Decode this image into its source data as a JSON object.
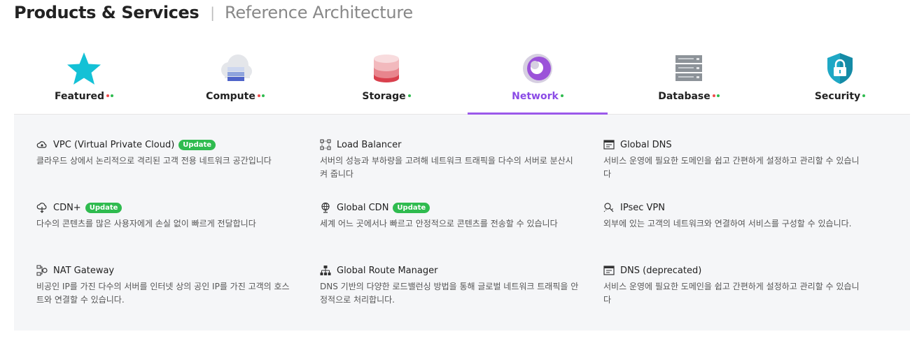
{
  "header": {
    "title": "Products & Services",
    "separator": "|",
    "subtitle": "Reference Architecture"
  },
  "tabs": [
    {
      "label": "Featured",
      "icon": "star-icon",
      "dots": [
        "red",
        "green"
      ],
      "active": false
    },
    {
      "label": "Compute",
      "icon": "cloud-server-icon",
      "dots": [
        "red",
        "green"
      ],
      "active": false
    },
    {
      "label": "Storage",
      "icon": "storage-drum-icon",
      "dots": [
        "green"
      ],
      "active": false
    },
    {
      "label": "Network",
      "icon": "network-swirl-icon",
      "dots": [
        "green"
      ],
      "active": true
    },
    {
      "label": "Database",
      "icon": "database-rack-icon",
      "dots": [
        "red",
        "green"
      ],
      "active": false
    },
    {
      "label": "Security",
      "icon": "shield-lock-icon",
      "dots": [
        "green"
      ],
      "active": false
    }
  ],
  "products": [
    {
      "name": "VPC (Virtual Private Cloud)",
      "badge": "Update",
      "icon": "cloud-gear-icon",
      "desc": "클라우드 상에서 논리적으로 격리된 고객 전용 네트워크 공간입니다"
    },
    {
      "name": "Load Balancer",
      "badge": "",
      "icon": "load-balancer-icon",
      "desc": "서버의 성능과 부하량을 고려해 네트워크 트래픽을 다수의 서버로 분산시켜 줍니다"
    },
    {
      "name": "Global DNS",
      "badge": "",
      "icon": "dns-window-icon",
      "desc": "서비스 운영에 필요한 도메인을 쉽고 간편하게 설정하고 관리할 수 있습니다"
    },
    {
      "name": "CDN+",
      "badge": "Update",
      "icon": "cloud-download-icon",
      "desc": "다수의 콘텐츠를 많은 사용자에게 손실 없이 빠르게 전달합니다"
    },
    {
      "name": "Global CDN",
      "badge": "Update",
      "icon": "globe-icon",
      "desc": "세계 어느 곳에서나 빠르고 안정적으로 콘텐츠를 전송할 수 있습니다"
    },
    {
      "name": "IPsec VPN",
      "badge": "",
      "icon": "vpn-link-icon",
      "desc": "외부에 있는 고객의 네트워크와 연결하여 서비스를 구성할 수 있습니다."
    },
    {
      "name": "NAT Gateway",
      "badge": "",
      "icon": "nat-gateway-icon",
      "desc": "비공인 IP를 가진 다수의 서버를 인터넷 상의 공인 IP를 가진 고객의 호스트와 연결할 수 있습니다."
    },
    {
      "name": "Global Route Manager",
      "badge": "",
      "icon": "route-tree-icon",
      "desc": "DNS 기반의 다양한 로드밸런싱 방법을 통해 글로벌 네트워크 트래픽을 안정적으로 처리합니다."
    },
    {
      "name": "DNS (deprecated)",
      "badge": "",
      "icon": "dns-window-icon",
      "desc": "서비스 운영에 필요한 도메인을 쉽고 간편하게 설정하고 관리할 수 있습니다"
    }
  ],
  "colors": {
    "accent": "#9b59ea",
    "badge": "#2fbb4f",
    "dot_red": "#ef4b4b",
    "dot_green": "#2fbb4f",
    "panel_bg": "#f5f6f8"
  }
}
